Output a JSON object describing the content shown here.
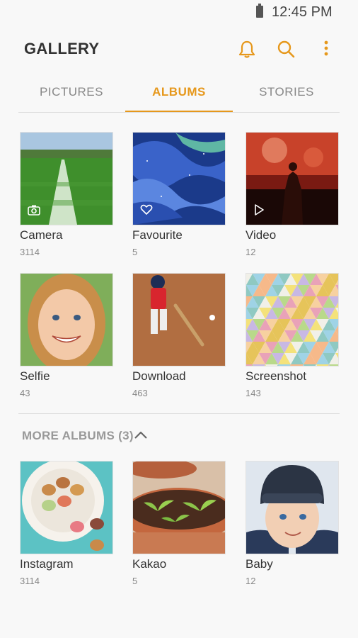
{
  "status": {
    "time": "12:45 PM"
  },
  "header": {
    "title": "GALLERY",
    "icons": [
      "bell-icon",
      "search-icon",
      "more-vertical-icon"
    ],
    "accent": "#e6981c"
  },
  "tabs": [
    {
      "label": "PICTURES",
      "active": false
    },
    {
      "label": "ALBUMS",
      "active": true
    },
    {
      "label": "STORIES",
      "active": false
    }
  ],
  "albums": [
    {
      "name": "Camera",
      "count": "3114",
      "badge": "camera-icon"
    },
    {
      "name": "Favourite",
      "count": "5",
      "badge": "heart-icon"
    },
    {
      "name": "Video",
      "count": "12",
      "badge": "play-icon"
    },
    {
      "name": "Selfie",
      "count": "43"
    },
    {
      "name": "Download",
      "count": "463"
    },
    {
      "name": "Screenshot",
      "count": "143"
    }
  ],
  "more_albums": {
    "label": "MORE ALBUMS (3)",
    "expanded": true,
    "items": [
      {
        "name": "Instagram",
        "count": "3114"
      },
      {
        "name": "Kakao",
        "count": "5"
      },
      {
        "name": "Baby",
        "count": "12"
      }
    ]
  }
}
